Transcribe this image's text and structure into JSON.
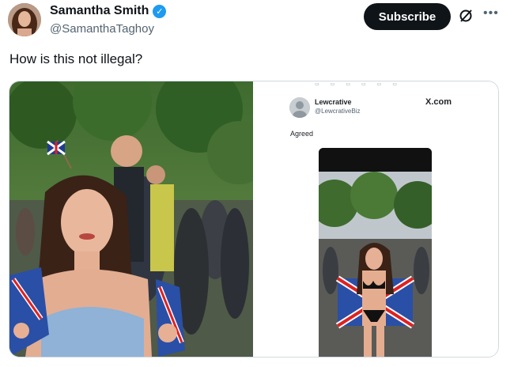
{
  "post": {
    "author_name": "Samantha Smith",
    "author_handle": "@SamanthaTaghoy",
    "text": "How is this not illegal?",
    "subscribe_label": "Subscribe",
    "verified_icon": "verified-badge-icon",
    "more_icon": "more-options-icon",
    "grok_icon": "grok-icon"
  },
  "quoted": {
    "author_name": "Lewcrative",
    "author_handle": "@LewcrativeBiz",
    "watermark": "X.com",
    "text": "Agreed"
  },
  "colors": {
    "accent": "#1d9bf0",
    "button": "#0f1419",
    "secondary_text": "#536471"
  }
}
